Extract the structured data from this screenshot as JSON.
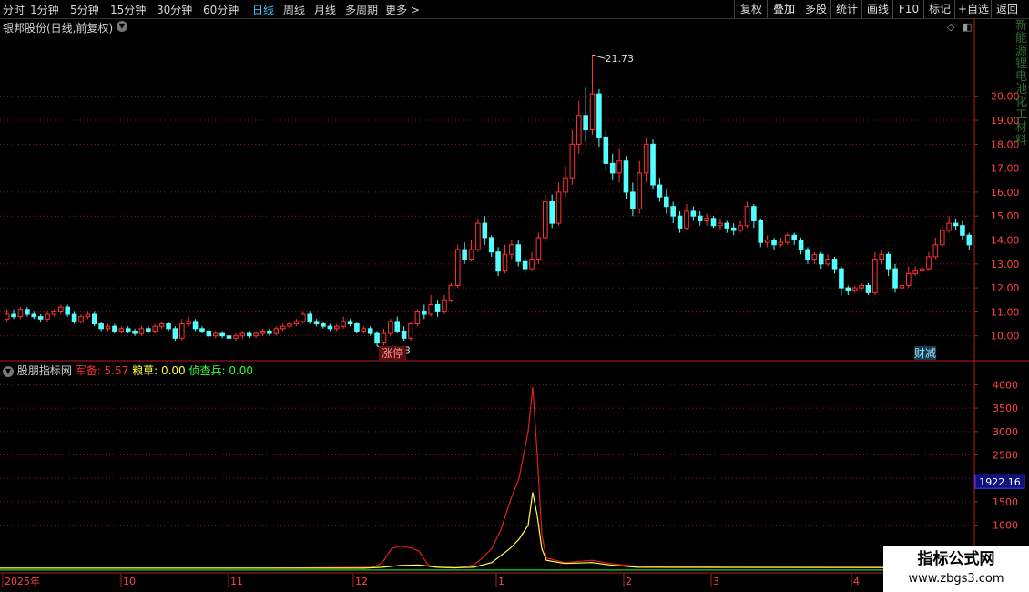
{
  "toolbar": {
    "periods": [
      "分时",
      "1分钟",
      "5分钟",
      "15分钟",
      "30分钟",
      "60分钟",
      "日线",
      "周线",
      "月线",
      "多周期",
      "更多 >"
    ],
    "active_period": "日线",
    "tools": [
      "复权",
      "叠加",
      "多股",
      "统计",
      "画线",
      "F10",
      "标记",
      "+自选",
      "返回"
    ]
  },
  "main": {
    "title": "银邦股份(日线,前复权)",
    "high_label": "21.73",
    "low_label": "9.58",
    "markers": [
      "涨停",
      "财减"
    ],
    "right_strip": "新能源锂电池化工材料"
  },
  "indicator": {
    "name": "股朋指标网",
    "items": [
      {
        "label": "军备: ",
        "value": "5.57",
        "color": "#ff3030"
      },
      {
        "label": "粮草: ",
        "value": "0.00",
        "color": "#ffff40"
      },
      {
        "label": "侦查兵: ",
        "value": "0.00",
        "color": "#30ff30"
      }
    ],
    "current_value": "1922.16"
  },
  "time_axis": [
    "2025年",
    "10",
    "11",
    "12",
    "1",
    "2",
    "3",
    "4"
  ],
  "watermark": {
    "line1": "指标公式网",
    "line2": "www.zbgs3.com"
  },
  "colors": {
    "up": "#ff3232",
    "down": "#54ffff",
    "grid": "#8a1c1c",
    "axis": "#b41e1e",
    "red_line": "#e02020",
    "yellow_line": "#ffff50",
    "green_line": "#20d020"
  },
  "chart_data": [
    {
      "type": "candlestick",
      "title": "银邦股份(日线,前复权)",
      "y_ticks": [
        10.0,
        11.0,
        12.0,
        13.0,
        14.0,
        15.0,
        16.0,
        17.0,
        18.0,
        19.0,
        20.0
      ],
      "ylim": [
        9.0,
        22.5
      ],
      "max": 21.73,
      "min": 9.58,
      "candles": [
        [
          10.7,
          10.9,
          11.1,
          10.6
        ],
        [
          10.9,
          10.8,
          11.1,
          10.7
        ],
        [
          10.8,
          11.1,
          11.2,
          10.7
        ],
        [
          11.1,
          10.9,
          11.2,
          10.8
        ],
        [
          10.9,
          10.8,
          11.0,
          10.7
        ],
        [
          10.8,
          10.7,
          10.9,
          10.6
        ],
        [
          10.7,
          10.9,
          11.0,
          10.6
        ],
        [
          10.9,
          11.0,
          11.1,
          10.8
        ],
        [
          11.0,
          11.2,
          11.3,
          10.9
        ],
        [
          11.2,
          10.9,
          11.3,
          10.8
        ],
        [
          10.9,
          10.6,
          11.0,
          10.5
        ],
        [
          10.6,
          10.8,
          10.9,
          10.5
        ],
        [
          10.8,
          10.9,
          11.0,
          10.7
        ],
        [
          10.9,
          10.5,
          11.0,
          10.4
        ],
        [
          10.5,
          10.3,
          10.6,
          10.2
        ],
        [
          10.3,
          10.4,
          10.5,
          10.2
        ],
        [
          10.4,
          10.2,
          10.5,
          10.1
        ],
        [
          10.2,
          10.3,
          10.4,
          10.1
        ],
        [
          10.3,
          10.2,
          10.4,
          10.1
        ],
        [
          10.2,
          10.1,
          10.3,
          10.0
        ],
        [
          10.1,
          10.3,
          10.4,
          10.0
        ],
        [
          10.3,
          10.2,
          10.4,
          10.1
        ],
        [
          10.2,
          10.4,
          10.5,
          10.1
        ],
        [
          10.4,
          10.5,
          10.6,
          10.3
        ],
        [
          10.5,
          10.3,
          10.6,
          10.2
        ],
        [
          10.3,
          9.9,
          10.4,
          9.8
        ],
        [
          9.9,
          10.5,
          10.7,
          9.8
        ],
        [
          10.5,
          10.6,
          10.8,
          10.4
        ],
        [
          10.6,
          10.3,
          10.7,
          10.2
        ],
        [
          10.3,
          10.2,
          10.4,
          10.1
        ],
        [
          10.2,
          10.0,
          10.3,
          9.9
        ],
        [
          10.0,
          10.1,
          10.2,
          9.9
        ],
        [
          10.1,
          10.0,
          10.2,
          9.9
        ],
        [
          10.0,
          9.9,
          10.1,
          9.8
        ],
        [
          9.9,
          10.0,
          10.1,
          9.8
        ],
        [
          10.0,
          10.1,
          10.2,
          9.9
        ],
        [
          10.1,
          10.0,
          10.2,
          9.9
        ],
        [
          10.0,
          10.1,
          10.2,
          9.9
        ],
        [
          10.1,
          10.2,
          10.3,
          10.0
        ],
        [
          10.2,
          10.1,
          10.3,
          10.0
        ],
        [
          10.1,
          10.3,
          10.4,
          10.0
        ],
        [
          10.3,
          10.4,
          10.5,
          10.2
        ],
        [
          10.4,
          10.5,
          10.6,
          10.3
        ],
        [
          10.5,
          10.6,
          10.7,
          10.4
        ],
        [
          10.6,
          10.9,
          11.0,
          10.5
        ],
        [
          10.9,
          10.6,
          11.0,
          10.5
        ],
        [
          10.6,
          10.5,
          10.7,
          10.4
        ],
        [
          10.5,
          10.4,
          10.6,
          10.3
        ],
        [
          10.4,
          10.3,
          10.5,
          10.2
        ],
        [
          10.3,
          10.4,
          10.5,
          10.2
        ],
        [
          10.4,
          10.6,
          10.8,
          10.3
        ],
        [
          10.6,
          10.5,
          10.7,
          10.4
        ],
        [
          10.5,
          10.2,
          10.6,
          10.1
        ],
        [
          10.2,
          10.3,
          10.4,
          10.1
        ],
        [
          10.3,
          10.1,
          10.4,
          10.0
        ],
        [
          10.1,
          9.7,
          10.2,
          9.58
        ],
        [
          9.7,
          10.1,
          10.3,
          9.6
        ],
        [
          10.1,
          10.6,
          10.7,
          10.0
        ],
        [
          10.6,
          10.2,
          10.8,
          10.1
        ],
        [
          10.2,
          9.9,
          10.4,
          9.8
        ],
        [
          9.9,
          10.5,
          10.6,
          9.8
        ],
        [
          10.5,
          11.0,
          11.1,
          10.4
        ],
        [
          11.0,
          10.9,
          11.3,
          10.7
        ],
        [
          10.9,
          11.3,
          11.7,
          10.8
        ],
        [
          11.3,
          11.0,
          11.5,
          10.8
        ],
        [
          11.0,
          11.5,
          11.7,
          10.9
        ],
        [
          11.5,
          12.1,
          12.2,
          11.4
        ],
        [
          12.1,
          13.6,
          13.8,
          12.0
        ],
        [
          13.6,
          13.2,
          13.9,
          13.0
        ],
        [
          13.2,
          13.6,
          14.0,
          13.1
        ],
        [
          13.6,
          14.7,
          14.9,
          13.5
        ],
        [
          14.7,
          14.1,
          15.0,
          13.8
        ],
        [
          14.1,
          13.5,
          14.2,
          13.3
        ],
        [
          13.5,
          12.7,
          13.7,
          12.5
        ],
        [
          12.7,
          13.4,
          13.8,
          12.6
        ],
        [
          13.4,
          13.8,
          14.0,
          13.2
        ],
        [
          13.8,
          13.1,
          14.0,
          12.9
        ],
        [
          13.1,
          12.8,
          13.3,
          12.6
        ],
        [
          12.8,
          13.2,
          13.5,
          12.7
        ],
        [
          13.2,
          14.1,
          14.3,
          13.0
        ],
        [
          14.1,
          15.6,
          15.9,
          13.9
        ],
        [
          15.6,
          14.7,
          15.9,
          14.5
        ],
        [
          14.7,
          16.0,
          16.4,
          14.6
        ],
        [
          16.0,
          16.6,
          17.1,
          15.8
        ],
        [
          16.6,
          18.0,
          18.6,
          16.3
        ],
        [
          18.0,
          19.2,
          19.8,
          17.6
        ],
        [
          19.2,
          18.6,
          20.4,
          18.1
        ],
        [
          18.6,
          20.1,
          21.73,
          18.4
        ],
        [
          20.1,
          18.3,
          20.3,
          17.9
        ],
        [
          18.3,
          17.2,
          18.6,
          16.9
        ],
        [
          17.2,
          16.8,
          17.6,
          16.5
        ],
        [
          16.8,
          17.3,
          17.8,
          16.4
        ],
        [
          17.3,
          16.0,
          17.5,
          15.7
        ],
        [
          16.0,
          15.3,
          16.4,
          15.0
        ],
        [
          15.3,
          16.8,
          17.3,
          15.1
        ],
        [
          16.8,
          18.0,
          18.3,
          16.4
        ],
        [
          18.0,
          16.3,
          18.2,
          16.1
        ],
        [
          16.3,
          15.8,
          16.6,
          15.6
        ],
        [
          15.8,
          15.4,
          16.1,
          15.1
        ],
        [
          15.4,
          15.0,
          15.6,
          14.7
        ],
        [
          15.0,
          14.5,
          15.2,
          14.3
        ],
        [
          14.5,
          15.2,
          15.5,
          14.4
        ],
        [
          15.2,
          15.0,
          15.4,
          14.8
        ],
        [
          15.0,
          14.8,
          15.2,
          14.6
        ],
        [
          14.8,
          14.9,
          15.1,
          14.6
        ],
        [
          14.9,
          14.6,
          15.0,
          14.5
        ],
        [
          14.6,
          14.7,
          14.9,
          14.4
        ],
        [
          14.7,
          14.5,
          14.8,
          14.3
        ],
        [
          14.5,
          14.4,
          14.7,
          14.2
        ],
        [
          14.4,
          14.6,
          14.8,
          14.3
        ],
        [
          14.6,
          15.4,
          15.6,
          14.5
        ],
        [
          15.4,
          14.8,
          15.5,
          14.5
        ],
        [
          14.8,
          13.9,
          14.9,
          13.7
        ],
        [
          13.9,
          14.0,
          14.2,
          13.7
        ],
        [
          14.0,
          13.8,
          14.1,
          13.6
        ],
        [
          13.8,
          13.9,
          14.1,
          13.7
        ],
        [
          13.9,
          14.2,
          14.3,
          13.8
        ],
        [
          14.2,
          14.0,
          14.3,
          13.8
        ],
        [
          14.0,
          13.6,
          14.1,
          13.4
        ],
        [
          13.6,
          13.2,
          13.7,
          13.0
        ],
        [
          13.2,
          13.4,
          13.5,
          13.0
        ],
        [
          13.4,
          13.0,
          13.5,
          12.8
        ],
        [
          13.0,
          13.2,
          13.4,
          12.9
        ],
        [
          13.2,
          12.8,
          13.3,
          12.6
        ],
        [
          12.8,
          12.0,
          12.9,
          11.7
        ],
        [
          12.0,
          11.9,
          12.1,
          11.7
        ],
        [
          11.9,
          12.0,
          12.1,
          11.8
        ],
        [
          12.0,
          12.1,
          12.2,
          11.9
        ],
        [
          12.1,
          11.8,
          12.2,
          11.7
        ],
        [
          11.8,
          13.2,
          13.5,
          11.7
        ],
        [
          13.2,
          13.4,
          13.6,
          13.0
        ],
        [
          13.4,
          12.8,
          13.5,
          12.5
        ],
        [
          12.8,
          12.0,
          13.0,
          11.8
        ],
        [
          12.0,
          12.1,
          12.3,
          11.9
        ],
        [
          12.1,
          12.6,
          12.9,
          12.0
        ],
        [
          12.6,
          12.7,
          12.9,
          12.5
        ],
        [
          12.7,
          12.8,
          13.0,
          12.6
        ],
        [
          12.8,
          13.3,
          13.5,
          12.7
        ],
        [
          13.3,
          13.8,
          14.1,
          13.2
        ],
        [
          13.8,
          14.4,
          14.6,
          13.7
        ],
        [
          14.4,
          14.7,
          15.0,
          14.3
        ],
        [
          14.7,
          14.6,
          14.9,
          14.4
        ],
        [
          14.6,
          14.2,
          14.8,
          14.0
        ],
        [
          14.2,
          13.8,
          14.3,
          13.6
        ]
      ]
    },
    {
      "type": "line",
      "title": "股朋指标网",
      "y_ticks": [
        1000,
        1500,
        2000,
        2500,
        3000,
        3500,
        4000
      ],
      "ylim": [
        0,
        4300
      ],
      "series": [
        {
          "name": "军备",
          "color": "#e02020",
          "points": [
            [
              0,
              80
            ],
            [
              100,
              80
            ],
            [
              300,
              80
            ],
            [
              410,
              100
            ],
            [
              420,
              200
            ],
            [
              430,
              500
            ],
            [
              440,
              550
            ],
            [
              450,
              520
            ],
            [
              460,
              450
            ],
            [
              470,
              150
            ],
            [
              480,
              100
            ],
            [
              500,
              80
            ],
            [
              520,
              150
            ],
            [
              530,
              300
            ],
            [
              540,
              500
            ],
            [
              550,
              900
            ],
            [
              560,
              1500
            ],
            [
              570,
              2000
            ],
            [
              580,
              3000
            ],
            [
              585,
              3950
            ],
            [
              590,
              2500
            ],
            [
              595,
              800
            ],
            [
              600,
              300
            ],
            [
              620,
              200
            ],
            [
              650,
              250
            ],
            [
              670,
              180
            ],
            [
              700,
              120
            ],
            [
              800,
              100
            ],
            [
              1070,
              100
            ]
          ]
        },
        {
          "name": "粮草",
          "color": "#ffff50",
          "points": [
            [
              0,
              80
            ],
            [
              400,
              80
            ],
            [
              420,
              100
            ],
            [
              440,
              140
            ],
            [
              460,
              150
            ],
            [
              480,
              100
            ],
            [
              500,
              90
            ],
            [
              520,
              100
            ],
            [
              540,
              200
            ],
            [
              560,
              500
            ],
            [
              570,
              700
            ],
            [
              580,
              1000
            ],
            [
              585,
              1700
            ],
            [
              590,
              1200
            ],
            [
              595,
              500
            ],
            [
              600,
              250
            ],
            [
              620,
              180
            ],
            [
              650,
              200
            ],
            [
              670,
              150
            ],
            [
              700,
              100
            ],
            [
              1070,
              90
            ]
          ]
        },
        {
          "name": "侦查兵",
          "color": "#20d020",
          "points": [
            [
              0,
              40
            ],
            [
              1070,
              40
            ]
          ]
        }
      ]
    }
  ]
}
